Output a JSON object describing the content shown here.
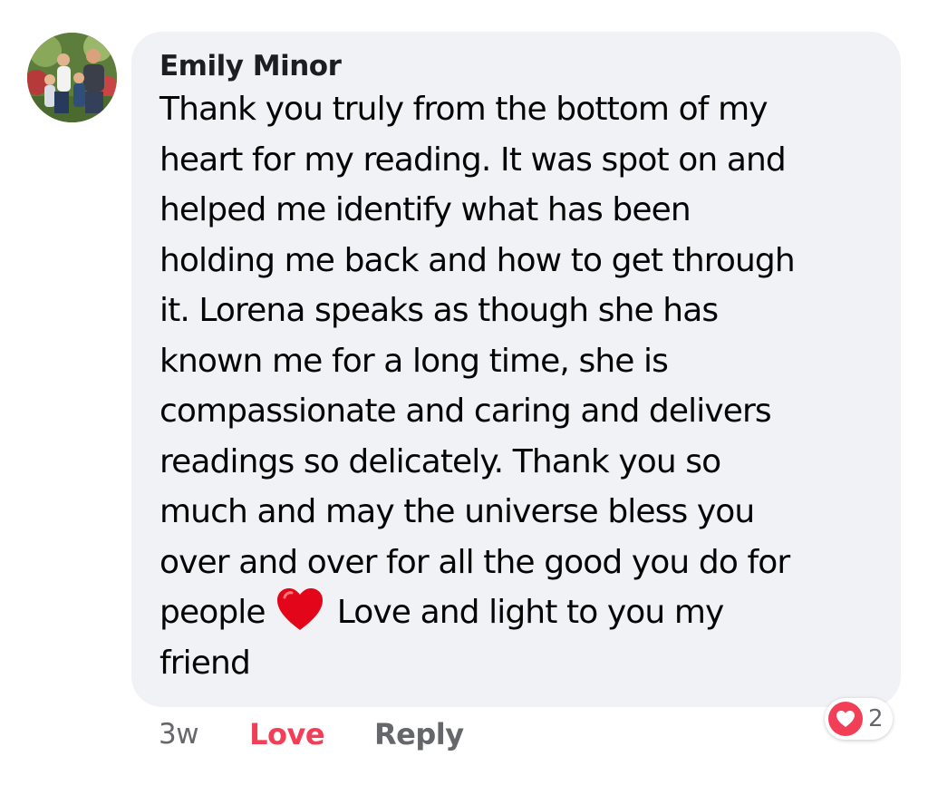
{
  "comment": {
    "author": "Emily Minor",
    "text_before_emoji": "Thank you truly from the bottom of my\nheart for my reading. It was spot on and\nhelped me identify what has been\nholding me back and how to get through\nit. Lorena speaks as though she has\nknown me for a long time, she is\ncompassionate and caring and delivers\nreadings so delicately. Thank you so\nmuch and may the universe bless you\nover and over for all the good you do for\npeople",
    "emoji": "red-heart",
    "text_after_emoji": "Love and light to you my\nfriend",
    "avatar": "family-photo-avatar"
  },
  "actions": {
    "time": "3w",
    "love_label": "Love",
    "reply_label": "Reply"
  },
  "reactions": {
    "icon": "heart-reaction-icon",
    "count": "2"
  },
  "colors": {
    "bubble": "#f0f2f5",
    "love": "#f33e58",
    "muted": "#65676b",
    "text": "#050505"
  }
}
